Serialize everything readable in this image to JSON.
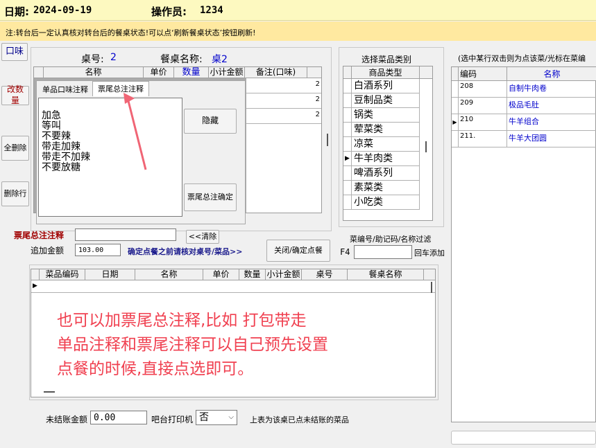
{
  "header": {
    "date_label": "日期:",
    "date_value": "2024-09-19",
    "operator_label": "操作员:",
    "operator_value": "1234",
    "notice": "注:转台后一定认真核对转台后的餐桌状态!可以点‘刷新餐桌状态’按钮刷新!"
  },
  "left_buttons": {
    "flavor": "口味",
    "change_qty": "改数量",
    "delete_all": "全删除",
    "delete_row": "删除行"
  },
  "table_info": {
    "table_no_label": "桌号:",
    "table_no_value": "2",
    "table_name_label": "餐桌名称:",
    "table_name_value": "桌2"
  },
  "order_grid": {
    "columns": [
      "名称",
      "单价",
      "数量",
      "小计金额",
      "备注(口味)"
    ],
    "row_marks": [
      "2",
      "2",
      "2"
    ]
  },
  "remark_tabs": {
    "tab1": "单品口味注释",
    "tab2": "票尾总注注释",
    "items": [
      "加急",
      "等叫",
      "不要辣",
      "带走加辣",
      "带走不加辣",
      "不要放糖"
    ],
    "hide_button": "隐藏",
    "confirm_button": "票尾总注确定"
  },
  "footer_remark": {
    "label": "票尾总注注释",
    "value": "",
    "clear_button": "<<清除"
  },
  "extra": {
    "label": "追加金额",
    "value": "103.00",
    "hint": "确定点餐之前请核对桌号/菜品>>",
    "close_button": "关闭/确定点餐"
  },
  "category": {
    "title": "选择菜品类别",
    "header": "商品类型",
    "items": [
      "白酒系列",
      "豆制品类",
      "锅类",
      "荤菜类",
      "凉菜",
      "牛羊肉类",
      "啤酒系列",
      "素菜类",
      "小吃类"
    ],
    "selected": "牛羊肉类"
  },
  "filter": {
    "label": "菜编号/助记码/名称过滤",
    "key": "F4",
    "value": "",
    "enter_hint": "回车添加"
  },
  "dish_list": {
    "title": "(选中某行双击则为点该菜/光标在菜编",
    "col_code": "编码",
    "col_name": "名称",
    "rows": [
      {
        "code": "208",
        "name": "自制牛肉卷"
      },
      {
        "code": "209",
        "name": "极品毛肚"
      },
      {
        "code": "210",
        "name": "牛羊组合"
      },
      {
        "code": "211.",
        "name": "牛羊大团圆"
      }
    ]
  },
  "unsettled_grid": {
    "columns": [
      "菜品编码",
      "日期",
      "名称",
      "单价",
      "数量",
      "小计金额",
      "桌号",
      "餐桌名称"
    ]
  },
  "annotation": {
    "line1": "也可以加票尾总注释,比如 打包带走",
    "line2": "单品注释和票尾注释可以自己预先设置",
    "line3": "点餐的时候,直接点选即可。"
  },
  "bottom": {
    "unsettled_label": "未结账金额",
    "unsettled_value": "0.00",
    "printer_label": "吧台打印机",
    "printer_value": "否",
    "note": "上表为该桌已点未结账的菜品"
  },
  "colors": {
    "header_bg": "#fdf9c0",
    "notice_bg": "#ffe9a0",
    "link_blue": "#0000cc",
    "annotation_red": "#f04050",
    "dark_red": "#a00000"
  }
}
